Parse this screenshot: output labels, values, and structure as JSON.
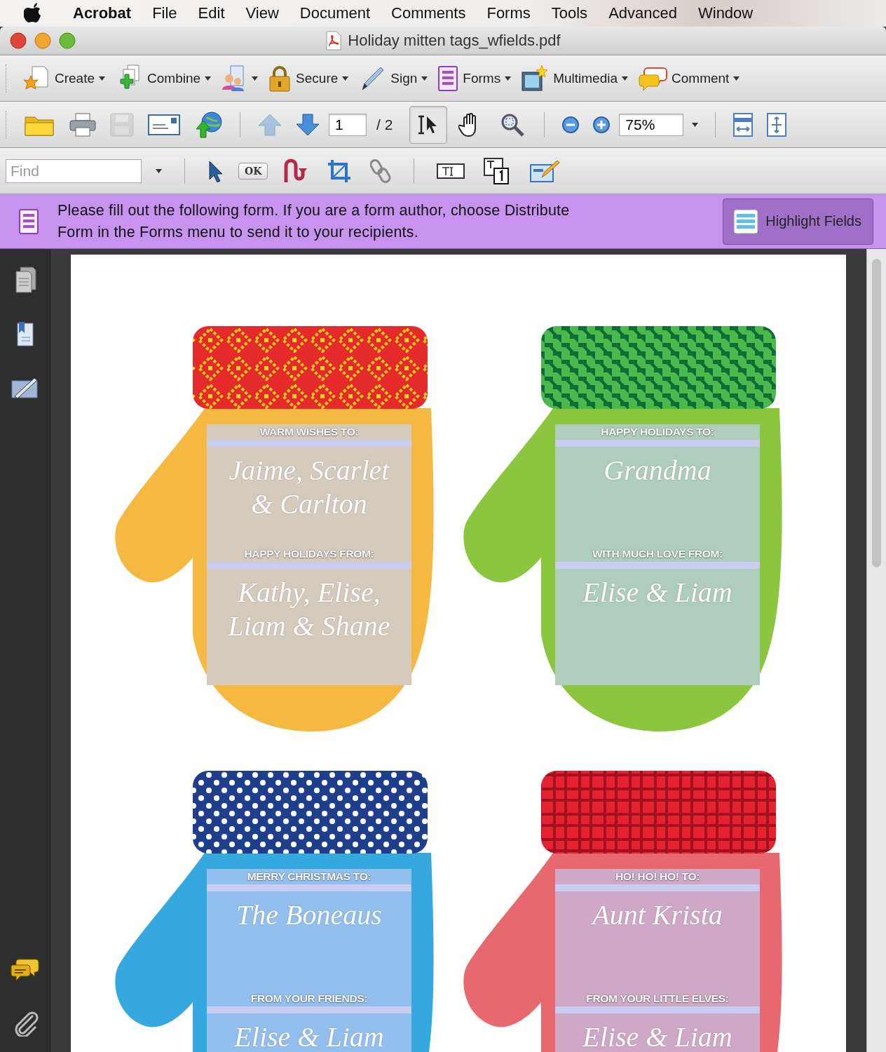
{
  "menubar": {
    "items": [
      {
        "label": "Acrobat",
        "kind": "app"
      },
      {
        "label": "File",
        "kind": "menu"
      },
      {
        "label": "Edit",
        "kind": "menu"
      },
      {
        "label": "View",
        "kind": "menu"
      },
      {
        "label": "Document",
        "kind": "menu"
      },
      {
        "label": "Comments",
        "kind": "menu"
      },
      {
        "label": "Forms",
        "kind": "menu"
      },
      {
        "label": "Tools",
        "kind": "menu"
      },
      {
        "label": "Advanced",
        "kind": "menu"
      },
      {
        "label": "Window",
        "kind": "menu"
      }
    ]
  },
  "window": {
    "title": "Holiday mitten tags_wfields.pdf"
  },
  "task_toolbar": {
    "buttons": [
      "Create",
      "Combine",
      "Secure",
      "Sign",
      "Forms",
      "Multimedia",
      "Comment"
    ]
  },
  "navigation": {
    "file_buttons": [
      {
        "disabled": false
      },
      {
        "disabled": false
      },
      {
        "disabled": true
      },
      {
        "disabled": false
      },
      {
        "disabled": false
      }
    ],
    "page_buttons": [
      {
        "disabled": true
      },
      {
        "disabled": false
      }
    ],
    "page": "1",
    "page_count": "/ 2",
    "tools": [
      {
        "selected": true
      },
      {
        "selected": false
      },
      {
        "selected": false
      }
    ],
    "zoom": "75%"
  },
  "forms_toolbar": {
    "find_placeholder": "Find",
    "ok_label": "OK"
  },
  "form_notice": {
    "message": "Please fill out the following form. If you are a form author, choose Distribute\nForm in the Forms menu to send it to your recipients.",
    "button": "Highlight Fields"
  },
  "mittens": [
    {
      "color": "#f5b942",
      "kind": "diamond",
      "to_label": "WARM WISHES TO:",
      "to_name": "Jaime, Scarlet\n& Carlton",
      "from_label": "HAPPY HOLIDAYS FROM:",
      "from_name": "Kathy, Elise,\nLiam & Shane"
    },
    {
      "color": "#8cc63f",
      "kind": "houndstooth",
      "to_label": "HAPPY HOLIDAYS TO:",
      "to_name": "Grandma",
      "from_label": "WITH MUCH LOVE FROM:",
      "from_name": "Elise & Liam"
    },
    {
      "color": "#35a9df",
      "kind": "dot",
      "to_label": "MERRY CHRISTMAS TO:",
      "to_name": "The Boneaus",
      "from_label": "FROM YOUR FRIENDS:",
      "from_name": "Elise & Liam"
    },
    {
      "color": "#e8686f",
      "kind": "plaid",
      "to_label": "HO! HO! HO! TO:",
      "to_name": "Aunt Krista",
      "from_label": "FROM YOUR LITTLE ELVES:",
      "from_name": "Elise & Liam"
    }
  ]
}
